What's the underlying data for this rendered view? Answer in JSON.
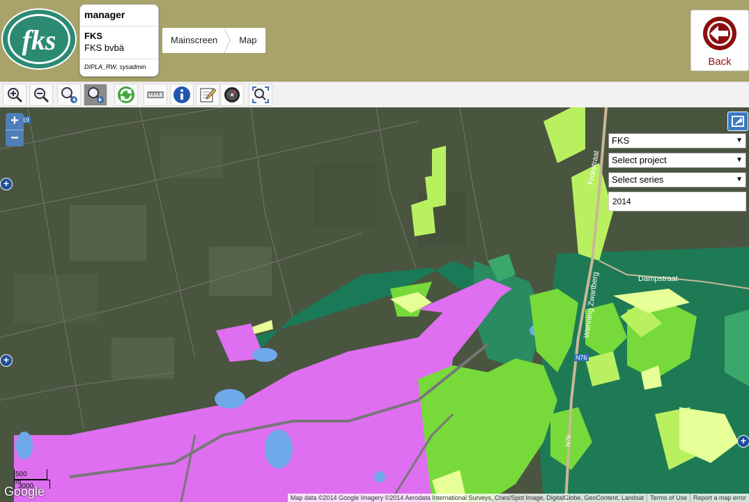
{
  "header": {
    "logo_text": "fks",
    "user_card": {
      "role": "manager",
      "org": "FKS",
      "org_name": "FKS bvbä",
      "permissions": "DIPLA_RW, sysadmin"
    },
    "breadcrumb": [
      "Mainscreen",
      "Map"
    ],
    "back_label": "Back"
  },
  "toolbar": {
    "tools": [
      {
        "icon": "zoom-in-icon"
      },
      {
        "icon": "zoom-out-icon"
      },
      {
        "icon": "zoom-previous-icon"
      },
      {
        "icon": "zoom-next-icon",
        "active": true
      },
      {
        "icon": "refresh-icon"
      },
      {
        "icon": "measure-icon"
      },
      {
        "icon": "info-icon"
      },
      {
        "icon": "edit-icon"
      },
      {
        "icon": "gauge-icon"
      },
      {
        "icon": "full-extent-icon"
      }
    ]
  },
  "map": {
    "zoom_in": "+",
    "zoom_out": "−",
    "selects": {
      "organization": "FKS",
      "project": "Select project",
      "series": "Select series"
    },
    "year": "2014",
    "labels": {
      "road_north": "Frokstraat",
      "road_dampstraat": "Dampstraat",
      "road_wenningerweg": "Wenning Zwartberg",
      "road_n76": "N76",
      "road_n76_south": "N76",
      "road_n19": "19"
    },
    "scale": {
      "metric": "500 m",
      "imperial": "3000 ft"
    },
    "google_logo": "Google",
    "attribution": {
      "map_data": "Map data ©2014 Google Imagery ©2014 Aerodata International Surveys, Cnes/Spot Image, DigitalGlobe, GeoContent, Landsat",
      "terms": "Terms of Use",
      "report": "Report a map error"
    }
  }
}
